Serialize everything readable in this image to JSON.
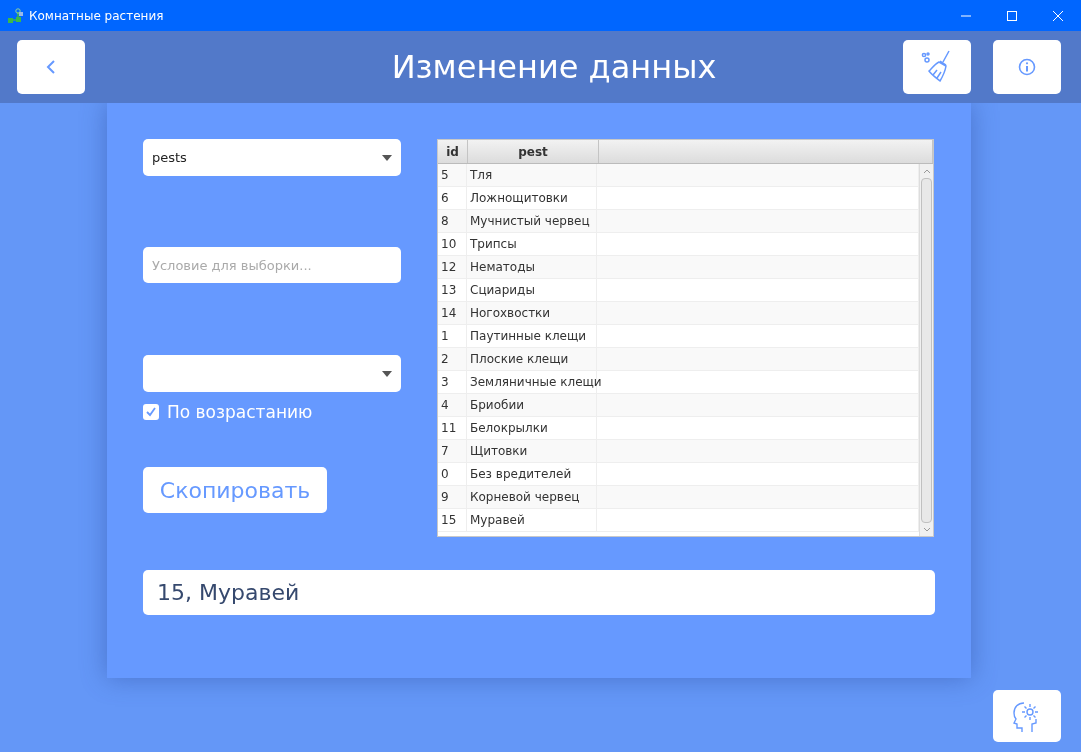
{
  "window": {
    "title": "Комнатные растения"
  },
  "header": {
    "title": "Изменение данных"
  },
  "table_select": {
    "value": "pests"
  },
  "condition_field": {
    "placeholder": "Условие для выборки..."
  },
  "ascending": {
    "label": "По возрастанию",
    "checked": true
  },
  "copy_button": {
    "label": "Скопировать"
  },
  "table": {
    "columns": [
      "id",
      "pest"
    ],
    "rows": [
      {
        "id": "5",
        "pest": "Тля"
      },
      {
        "id": "6",
        "pest": "Ложнощитовки"
      },
      {
        "id": "8",
        "pest": "Мучнистый червец"
      },
      {
        "id": "10",
        "pest": "Трипсы"
      },
      {
        "id": "12",
        "pest": "Нематоды"
      },
      {
        "id": "13",
        "pest": "Сциариды"
      },
      {
        "id": "14",
        "pest": "Ногохвостки"
      },
      {
        "id": "1",
        "pest": "Паутинные клещи"
      },
      {
        "id": "2",
        "pest": "Плоские клещи"
      },
      {
        "id": "3",
        "pest": "Земляничные клещи"
      },
      {
        "id": "4",
        "pest": "Бриобии"
      },
      {
        "id": "11",
        "pest": "Белокрылки"
      },
      {
        "id": "7",
        "pest": "Щитовки"
      },
      {
        "id": "0",
        "pest": "Без вредителей"
      },
      {
        "id": "9",
        "pest": "Корневой червец"
      },
      {
        "id": "15",
        "pest": "Муравей"
      }
    ]
  },
  "result_field": {
    "value": "15, Муравей"
  }
}
